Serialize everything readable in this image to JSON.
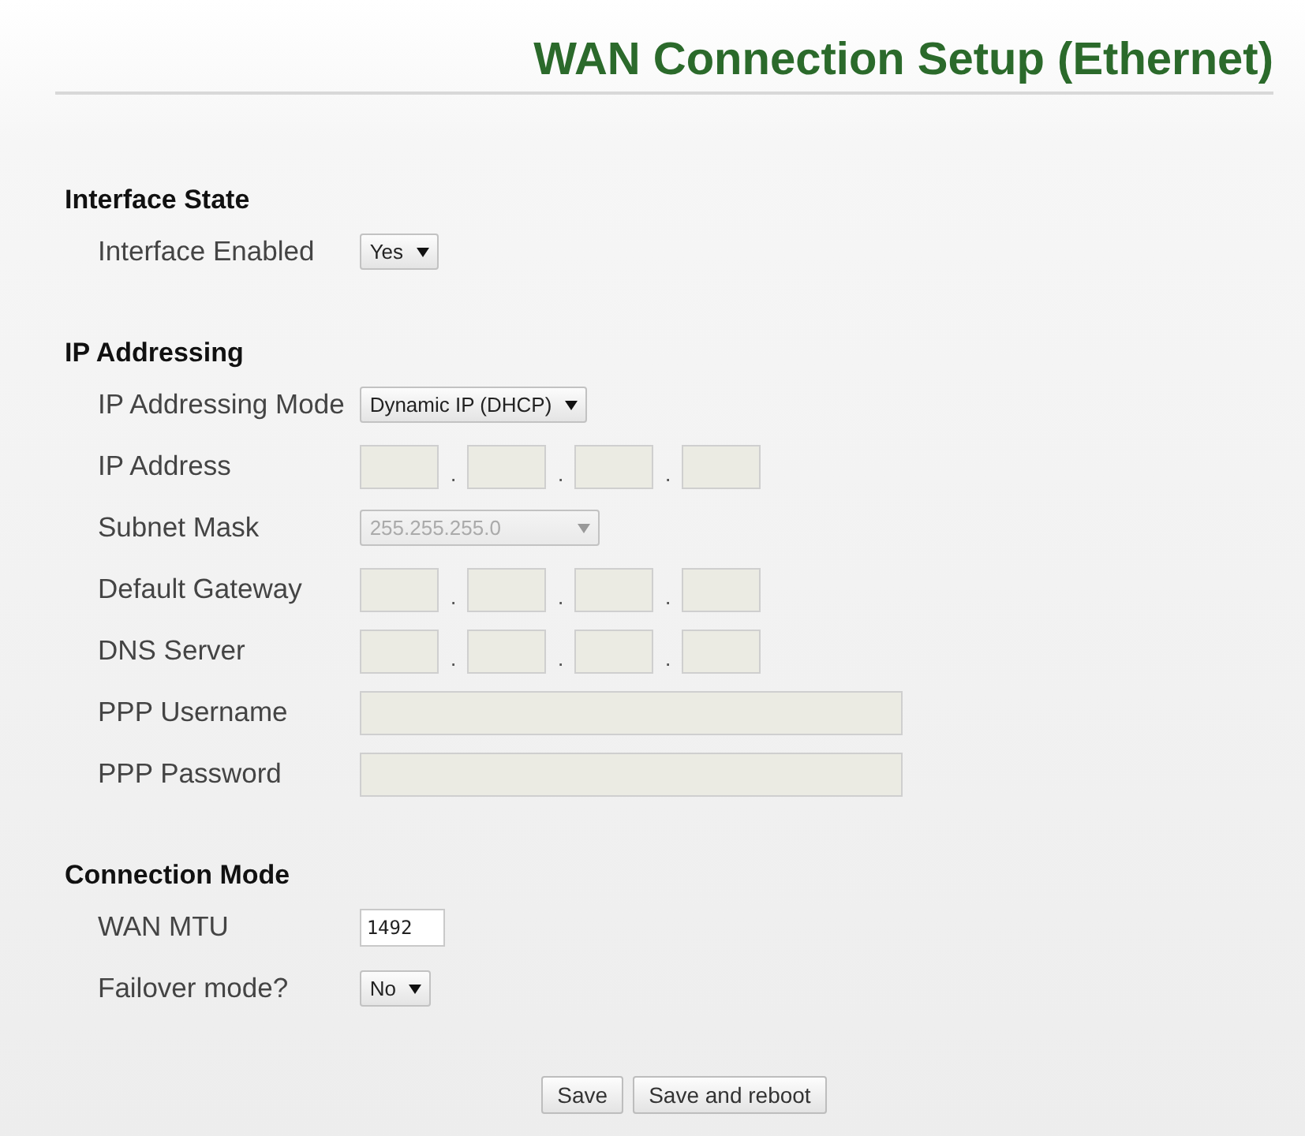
{
  "page": {
    "title": "WAN Connection Setup (Ethernet)"
  },
  "sections": [
    {
      "heading": "Interface State",
      "rows": [
        {
          "label": "Interface Enabled",
          "kind": "select",
          "value": "Yes",
          "disabled": false
        }
      ]
    },
    {
      "heading": "IP Addressing",
      "rows": [
        {
          "label": "IP Addressing Mode",
          "kind": "select",
          "value": "Dynamic IP (DHCP)",
          "disabled": false
        },
        {
          "label": "IP Address",
          "kind": "ip",
          "separators": [
            ".",
            ".",
            "."
          ],
          "disabled": true
        },
        {
          "label": "Subnet Mask",
          "kind": "select",
          "value": "255.255.255.0",
          "disabled": true
        },
        {
          "label": "Default Gateway",
          "kind": "ip",
          "separators": [
            ".",
            ".",
            "."
          ],
          "disabled": true
        },
        {
          "label": "DNS Server",
          "kind": "ip",
          "separators": [
            ".",
            ".",
            "."
          ],
          "disabled": true
        },
        {
          "label": "PPP Username",
          "kind": "text",
          "disabled": true
        },
        {
          "label": "PPP Password",
          "kind": "text",
          "disabled": true
        }
      ]
    },
    {
      "heading": "Connection Mode",
      "rows": [
        {
          "label": "WAN MTU",
          "kind": "number",
          "value": "1492",
          "disabled": false
        },
        {
          "label": "Failover mode?",
          "kind": "select",
          "value": "No",
          "disabled": false
        }
      ]
    }
  ],
  "buttons": [
    "Save",
    "Save and reboot"
  ]
}
